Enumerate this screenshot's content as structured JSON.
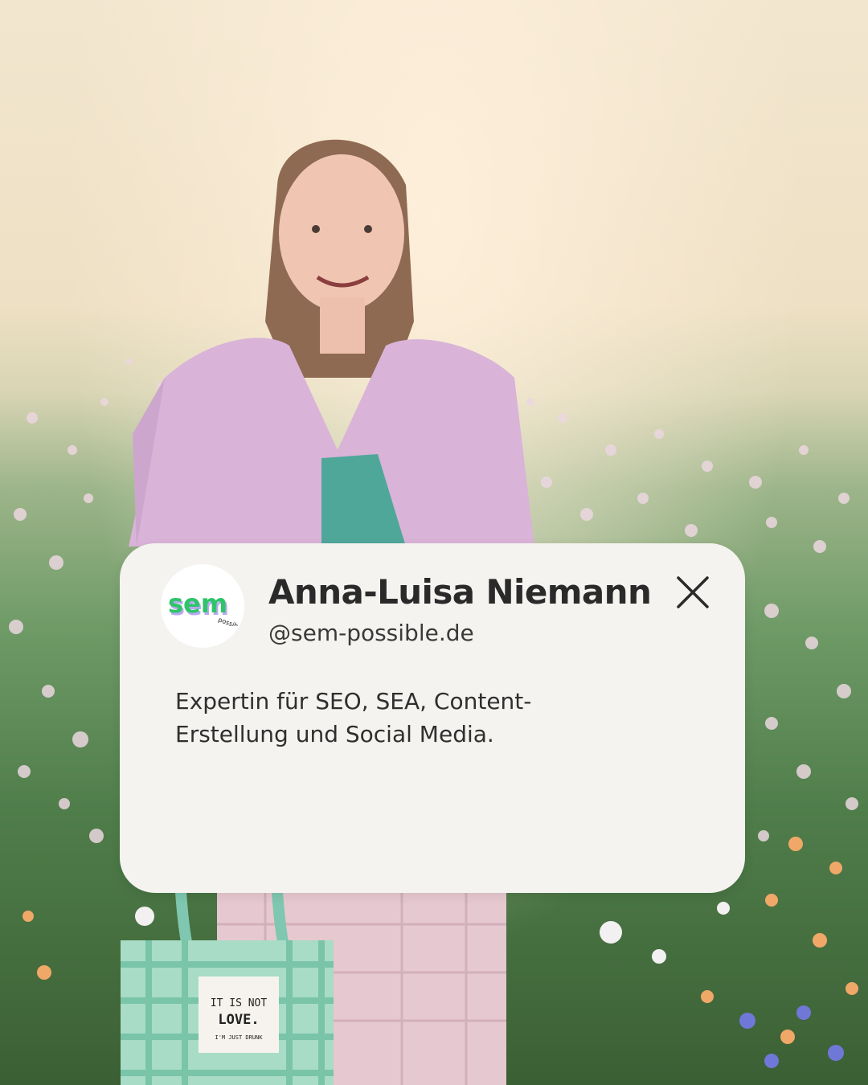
{
  "profile": {
    "name": "Anna-Luisa Niemann",
    "handle": "@sem-possible.de",
    "bio_line1": "Expertin für SEO, SEA, Content-",
    "bio_line2": "Erstellung und Social Media.",
    "logo_text": "sem",
    "logo_subtext": "possible"
  },
  "photo": {
    "bag_line1": "IT IS NOT",
    "bag_line2": "LOVE.",
    "bag_line3": "I'M JUST DRUNK"
  },
  "icons": {
    "close": "close-icon"
  },
  "colors": {
    "brand_green": "#2fc46a",
    "card_bg": "#f4f3f0"
  }
}
